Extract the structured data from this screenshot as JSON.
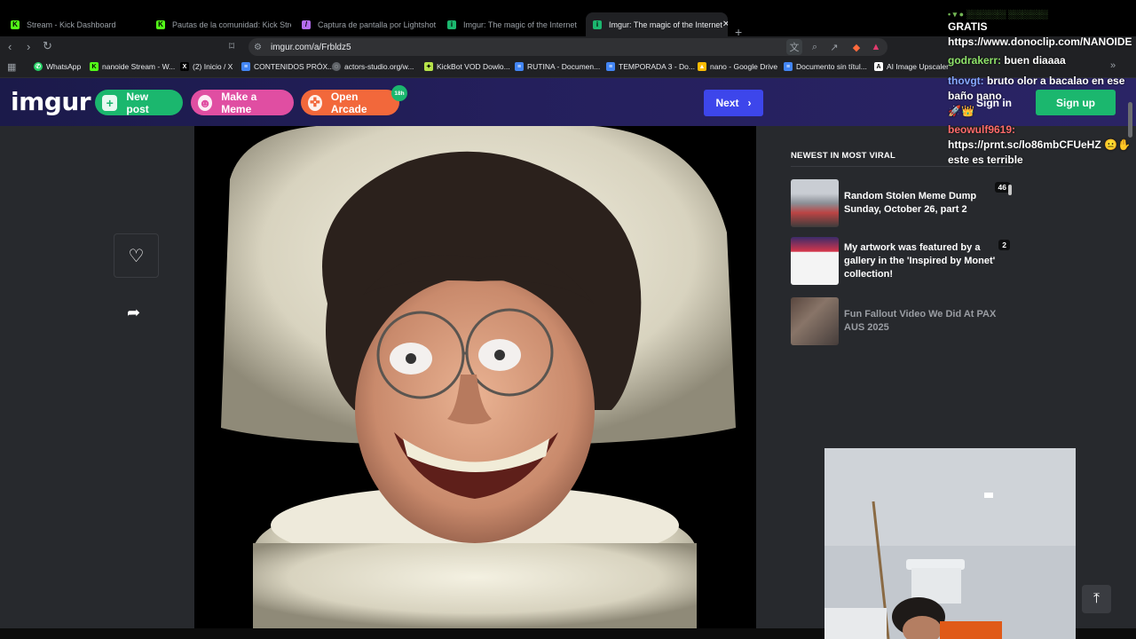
{
  "browser": {
    "tabs": [
      {
        "label": "Stream - Kick Dashboard",
        "icon": "kick-icon",
        "color": "#53fc18"
      },
      {
        "label": "Pautas de la comunidad: Kick Stream",
        "icon": "kick-icon",
        "color": "#53fc18"
      },
      {
        "label": "Captura de pantalla por Lightshot",
        "icon": "lightshot-icon",
        "color": "#b56cf0"
      },
      {
        "label": "Imgur: The magic of the Internet",
        "icon": "imgur-icon",
        "color": "#1bb76e"
      },
      {
        "label": "Imgur: The magic of the Internet",
        "icon": "imgur-icon",
        "color": "#1bb76e",
        "active": true
      }
    ],
    "url": "imgur.com/a/Frbldz5",
    "bookmarks": [
      {
        "label": "WhatsApp",
        "icon": "whatsapp-icon",
        "color": "#25d366"
      },
      {
        "label": "nanoide Stream - W...",
        "icon": "kick-icon",
        "color": "#53fc18"
      },
      {
        "label": "(2) Inicio / X",
        "icon": "x-icon",
        "color": "#000000"
      },
      {
        "label": "CONTENIDOS PRÓX...",
        "icon": "docs-icon",
        "color": "#4285f4"
      },
      {
        "label": "actors-studio.org/w...",
        "icon": "globe-icon",
        "color": "#5f6368"
      },
      {
        "label": "KickBot VOD Dowlo...",
        "icon": "kickbot-icon",
        "color": "#b6e34a"
      },
      {
        "label": "RUTINA - Documen...",
        "icon": "docs-icon",
        "color": "#4285f4"
      },
      {
        "label": "TEMPORADA 3 - Do...",
        "icon": "docs-icon",
        "color": "#4285f4"
      },
      {
        "label": "nano - Google Drive",
        "icon": "drive-icon",
        "color": "#fbbc04"
      },
      {
        "label": "Documento sin títul...",
        "icon": "docs-icon",
        "color": "#4285f4"
      },
      {
        "label": "AI Image Upscaler",
        "icon": "upscaler-icon",
        "color": "#ffffff"
      }
    ]
  },
  "imgur": {
    "logo": "imgur",
    "new_post": "New post",
    "make_meme": "Make a Meme",
    "open_arcade": "Open Arcade",
    "arcade_badge": "18h",
    "next": "Next",
    "sign_in": "Sign in",
    "sign_up": "Sign up"
  },
  "sidebar": {
    "title": "NEWEST IN MOST VIRAL",
    "items": [
      {
        "title": "Random Stolen Meme Dump Sunday, October 26, part 2",
        "count": "46"
      },
      {
        "title": "My artwork was featured by a gallery in the 'Inspired by Monet' collection!",
        "count": "2"
      },
      {
        "title": "Fun Fallout Video We Did At PAX AUS 2025",
        "count": ""
      }
    ]
  },
  "chat": {
    "top_partial": "• ▾ ● ░░░░░░░ ░░░░░░░",
    "line1": "GRATIS",
    "line2": "https://www.donoclip.com/NANOIDE",
    "messages": [
      {
        "user": "godrakerr:",
        "text": " buen diaaaa",
        "color": "#8fe36a"
      },
      {
        "user": "thovgt:",
        "text": " bruto olor a bacalao en ese baño nano",
        "color": "#86a9ff"
      },
      {
        "user": "",
        "text": "🚀👑",
        "color": "#ffffff"
      },
      {
        "user": "beowulf9619:",
        "text": " https://prnt.sc/lo86mbCFUeHZ 😐✋ este es terrible",
        "color": "#ff6b6b"
      }
    ]
  }
}
